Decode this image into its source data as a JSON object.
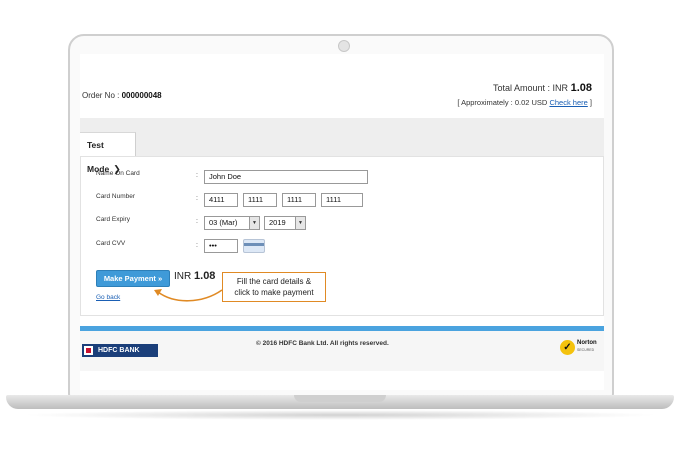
{
  "header": {
    "order_label": "Order No :",
    "order_number": "000000048",
    "total_label": "Total Amount : INR",
    "total_value": "1.08",
    "approx_text": "[ Approximately : 0.02 USD",
    "check_here": "Check here",
    "approx_close": "]"
  },
  "mode_tab": {
    "label": "Test Mode",
    "chevron": "❯"
  },
  "form": {
    "name_label": "Name On Card",
    "name_value": "John Doe",
    "card_number_label": "Card Number",
    "card_number": [
      "4111",
      "1111",
      "1111",
      "1111"
    ],
    "expiry_label": "Card Expiry",
    "expiry_month": "03 (Mar)",
    "expiry_year": "2019",
    "cvv_label": "Card CVV",
    "cvv_value": "•••",
    "colon": ":"
  },
  "actions": {
    "pay_button": "Make Payment »",
    "amount_prefix": "INR",
    "amount_value": "1.08",
    "go_back": "Go back"
  },
  "callout": {
    "line1": "Fill the card details &",
    "line2": "click to make payment"
  },
  "footer": {
    "bank_logo_text": "HDFC BANK",
    "copyright": "© 2016 HDFC Bank Ltd. All rights reserved.",
    "norton_text": "Norton",
    "norton_sub": "SECURED"
  },
  "colors": {
    "accent_blue": "#4aa3df",
    "callout_orange": "#e08a24",
    "bank_blue": "#1b3f7a"
  }
}
